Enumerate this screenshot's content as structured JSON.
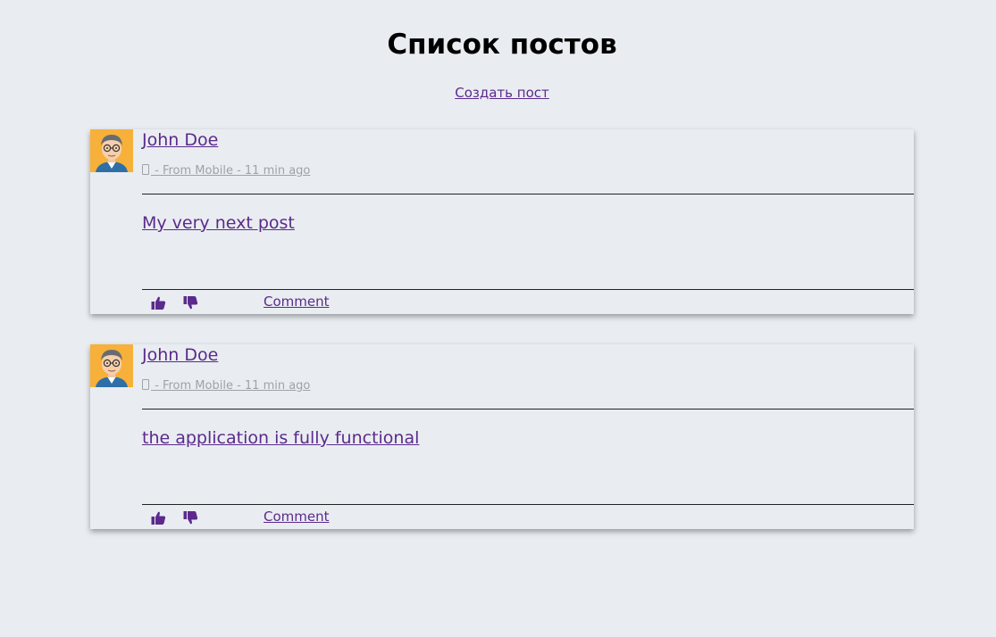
{
  "page": {
    "title": "Список постов",
    "create_post_label": "Создать пост"
  },
  "posts": [
    {
      "author": "John Doe",
      "source": " - From Mobile - 11 min ago",
      "text": "My very next post",
      "comment_label": "Comment"
    },
    {
      "author": "John Doe",
      "source": " - From Mobile - 11 min ago",
      "text": "the application is fully functional",
      "comment_label": "Comment"
    }
  ],
  "icons": {
    "like": "thumbs-up-icon",
    "dislike": "thumbs-down-icon",
    "device": "mobile-phone-icon"
  },
  "colors": {
    "background": "#e9edf1",
    "link": "#5b2a8c",
    "meta": "#9ea3a9",
    "avatar_bg": "#f7b03a"
  }
}
